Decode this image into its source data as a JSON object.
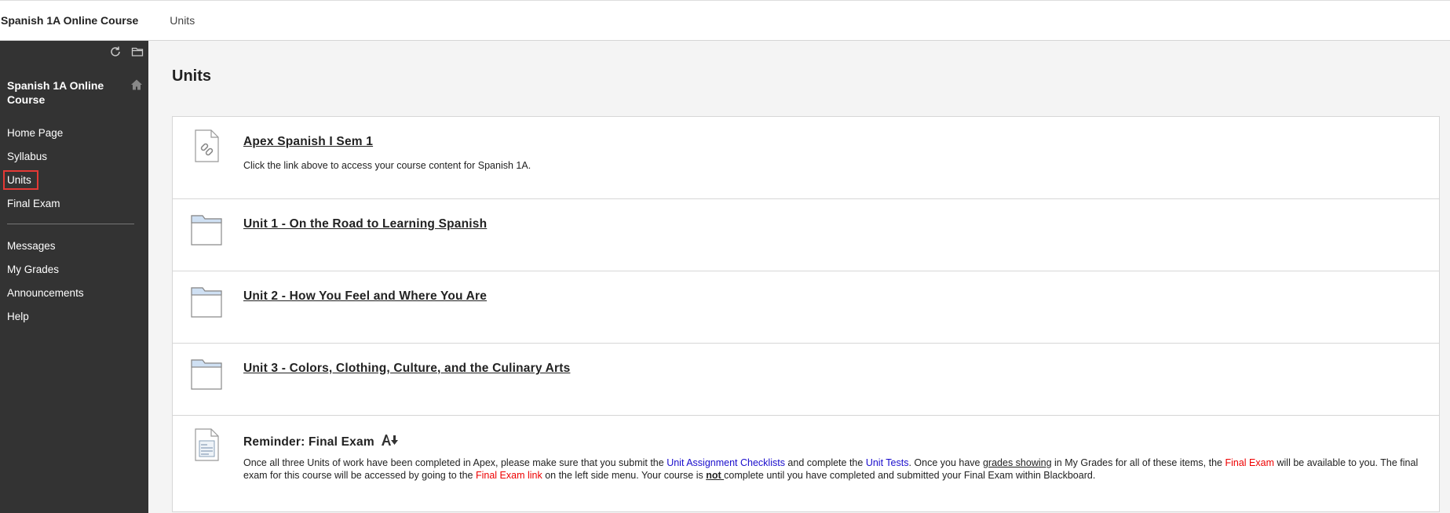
{
  "breadcrumb": {
    "course": "Spanish 1A Online Course",
    "page": "Units"
  },
  "sidebar": {
    "course_title": "Spanish 1A Online Course",
    "menu_primary": [
      {
        "label": "Home Page",
        "active": false
      },
      {
        "label": "Syllabus",
        "active": false
      },
      {
        "label": "Units",
        "active": true
      },
      {
        "label": "Final Exam",
        "active": false
      }
    ],
    "menu_secondary": [
      {
        "label": "Messages"
      },
      {
        "label": "My Grades"
      },
      {
        "label": "Announcements"
      },
      {
        "label": "Help"
      }
    ],
    "icons": [
      "refresh-icon",
      "folder-icon",
      "home-icon"
    ]
  },
  "main": {
    "title": "Units",
    "items": [
      {
        "icon": "web-link-icon",
        "title": "Apex Spanish I Sem 1",
        "desc": "Click the link above to access your course content for Spanish 1A."
      },
      {
        "icon": "folder-icon",
        "title": "Unit 1 - On the Road to Learning Spanish"
      },
      {
        "icon": "folder-icon",
        "title": "Unit 2 - How You Feel and Where You Are"
      },
      {
        "icon": "folder-icon",
        "title": "Unit 3 - Colors, Clothing, Culture, and the Culinary Arts"
      },
      {
        "icon": "document-icon",
        "title": "Reminder: Final Exam",
        "body": {
          "t1": "Once all three Units of work have been completed in Apex, please make sure that you submit the ",
          "l1": "Unit Assignment Checklists",
          "t2": " and complete the ",
          "l2": "Unit Tests",
          "t3": ".  Once you have ",
          "u1": "grades showing",
          "t4": " in My Grades for all of these items, the ",
          "r1": "Final Exam",
          "t5": " will be available to you.  The final exam for this course will be accessed by going to the ",
          "r2": "Final Exam link",
          "t6": " on the left side menu.  Your course is ",
          "b1": "not ",
          "t7": "complete until you have completed and submitted your Final Exam within Blackboard."
        }
      }
    ]
  },
  "colors": {
    "sidebar_bg": "#333333",
    "link_blue": "#1a0dcc",
    "highlight_red": "#e00000",
    "active_outline": "#e53935"
  }
}
